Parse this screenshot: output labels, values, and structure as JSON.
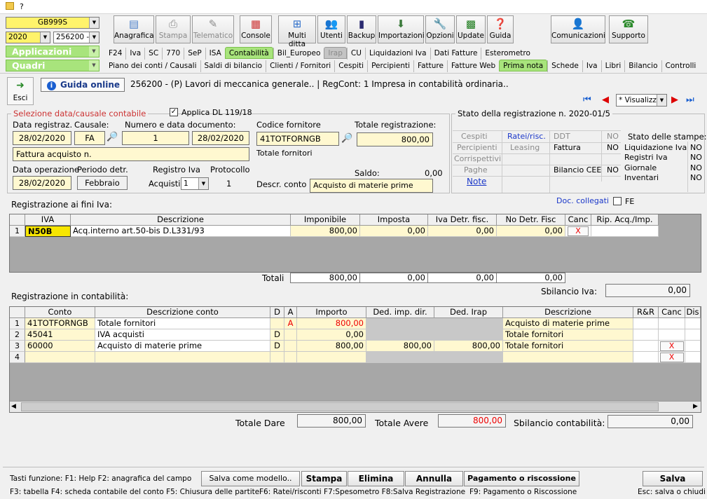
{
  "titlebar": {
    "icon": "folder-icon",
    "text": "?"
  },
  "left": {
    "company_code": "GB999S",
    "year": "2020",
    "ledger": "256200 -",
    "applicazioni": "Applicazioni",
    "quadri": "Quadri"
  },
  "toolbar": {
    "anagrafica": "Anagrafica",
    "stampa": "Stampa",
    "telematico": "Telematico",
    "console": "Console",
    "multi": "Multi ditta",
    "utenti": "Utenti",
    "backup": "Backup",
    "importazioni": "Importazioni",
    "opzioni": "Opzioni",
    "update": "Update",
    "guida": "Guida",
    "comunicazioni": "Comunicazioni",
    "supporto": "Supporto"
  },
  "tabs1": [
    "F24",
    "Iva",
    "SC",
    "770",
    "SeP",
    "ISA",
    "Contabilità",
    "Bil_Europeo",
    "Irap",
    "CU",
    "Liquidazioni Iva",
    "Dati Fatture",
    "Esterometro"
  ],
  "tabs2": [
    "Piano dei conti / Causali",
    "Saldi di bilancio",
    "Clienti / Fornitori",
    "Cespiti",
    "Percipienti",
    "Fatture",
    "Fatture Web",
    "Prima nota",
    "Schede",
    "Iva",
    "Libri",
    "Bilancio",
    "Controlli"
  ],
  "header": {
    "esci": "Esci",
    "guida_online": "Guida online",
    "company_info": "256200 - (P) Lavori di meccanica generale.. | RegCont: 1 Impresa  in contabilità ordinaria..",
    "nav_view": "* Visualizz"
  },
  "selezione": {
    "title": "Selezione data/causale contabile",
    "applica": "Applica DL 119/18",
    "l_data_reg": "Data registraz.",
    "l_causale": "Causale:",
    "l_num_doc": "Numero e data documento:",
    "data_reg": "28/02/2020",
    "causale": "FA",
    "numero": "1",
    "data_doc": "28/02/2020",
    "causale_desc": "Fattura acquisto n.",
    "l_data_op": "Data operazione",
    "l_periodo": "Periodo detr.",
    "l_registro": "Registro Iva",
    "l_protocollo": "Protocollo",
    "data_op": "28/02/2020",
    "periodo": "Febbraio",
    "l_acquisti": "Acquisti",
    "registro": "1",
    "protocollo": "1"
  },
  "fornitore": {
    "l_codice": "Codice fornitore",
    "codice": "41TOTFORNGB",
    "l_totale": "Totale registrazione:",
    "totale": "800,00",
    "desc": "Totale fornitori",
    "l_saldo": "Saldo:",
    "saldo": "0,00",
    "l_descr_conto": "Descr. conto",
    "descr_conto": "Acquisto di materie prime"
  },
  "stato": {
    "title": "Stato della registrazione n. 2020-01/5",
    "cespiti": "Cespiti",
    "ratei": "Ratei/risc.",
    "ddt": "DDT",
    "ddt_v": "NO",
    "percipienti": "Percipienti",
    "leasing": "Leasing",
    "fattura": "Fattura",
    "fattura_v": "NO",
    "corrispettivi": "Corrispettivi",
    "paghe": "Paghe",
    "bilancio_cee": "Bilancio CEE",
    "bilancio_v": "NO",
    "note": "Note",
    "stampe_title": "Stato delle stampe:",
    "stampe": [
      {
        "label": "Liquidazione Iva",
        "v": "NO"
      },
      {
        "label": "Registri Iva",
        "v": "NO"
      },
      {
        "label": "Giornale",
        "v": "NO"
      },
      {
        "label": "Inventari",
        "v": "NO"
      }
    ]
  },
  "iva": {
    "title": "Registrazione ai fini Iva:",
    "doc_collegati": "Doc. collegati",
    "fe": "FE",
    "headers": [
      "IVA",
      "Descrizione",
      "Imponibile",
      "Imposta",
      "Iva Detr. fisc.",
      "No Detr. Fisc",
      "Canc",
      "Rip. Acq./Imp."
    ],
    "rows": [
      {
        "n": "1",
        "iva": "N50B",
        "desc": "Acq.interno art.50-bis D.L331/93",
        "imponibile": "800,00",
        "imposta": "0,00",
        "detr": "0,00",
        "nodetr": "0,00",
        "canc": "X"
      }
    ],
    "totali_label": "Totali",
    "totali": [
      "800,00",
      "0,00",
      "0,00",
      "0,00"
    ],
    "sbilancio_label": "Sbilancio Iva:",
    "sbilancio": "0,00"
  },
  "cont": {
    "title": "Registrazione in contabilità:",
    "headers": [
      "Conto",
      "Descrizione conto",
      "D",
      "A",
      "Importo",
      "Ded. imp. dir.",
      "Ded. Irap",
      "Descrizione",
      "R&R",
      "Canc",
      "Dis"
    ],
    "rows": [
      {
        "n": "1",
        "conto": "41TOTFORNGB",
        "desc": "Totale fornitori",
        "d": "",
        "a": "A",
        "importo": "800,00",
        "ded": "",
        "irap": "",
        "descr": "Acquisto di materie prime",
        "canc": ""
      },
      {
        "n": "2",
        "conto": "45041",
        "desc": "IVA acquisti",
        "d": "D",
        "a": "",
        "importo": "0,00",
        "ded": "",
        "irap": "",
        "descr": "Totale fornitori",
        "canc": ""
      },
      {
        "n": "3",
        "conto": "60000",
        "desc": "Acquisto di materie prime",
        "d": "D",
        "a": "",
        "importo": "800,00",
        "ded": "800,00",
        "irap": "800,00",
        "descr": "Totale fornitori",
        "canc": "X"
      },
      {
        "n": "4",
        "conto": "",
        "desc": "",
        "d": "",
        "a": "",
        "importo": "",
        "ded": "",
        "irap": "",
        "descr": "",
        "canc": "X"
      }
    ],
    "totale_dare_label": "Totale Dare",
    "totale_dare": "800,00",
    "totale_avere_label": "Totale Avere",
    "totale_avere": "800,00",
    "sbilancio_label": "Sbilancio contabilità:",
    "sbilancio": "0,00"
  },
  "footer": {
    "tasti": "Tasti funzione: F1: Help  F2: anagrafica del campo",
    "salva_modello": "Salva come modello..",
    "stampa": "Stampa",
    "elimina": "Elimina",
    "annulla": "Annulla",
    "pagamento": "Pagamento o riscossione",
    "salva": "Salva",
    "keys2": "F3: tabella   F4: scheda contabile del conto   F5: Chiusura delle partite",
    "keys3": "F6: Ratei/risconti   F7:Spesometro   F8:Salva Registrazione",
    "keys4": "F9: Pagamento o Riscossione",
    "esc": "Esc: salva o chiudi"
  }
}
